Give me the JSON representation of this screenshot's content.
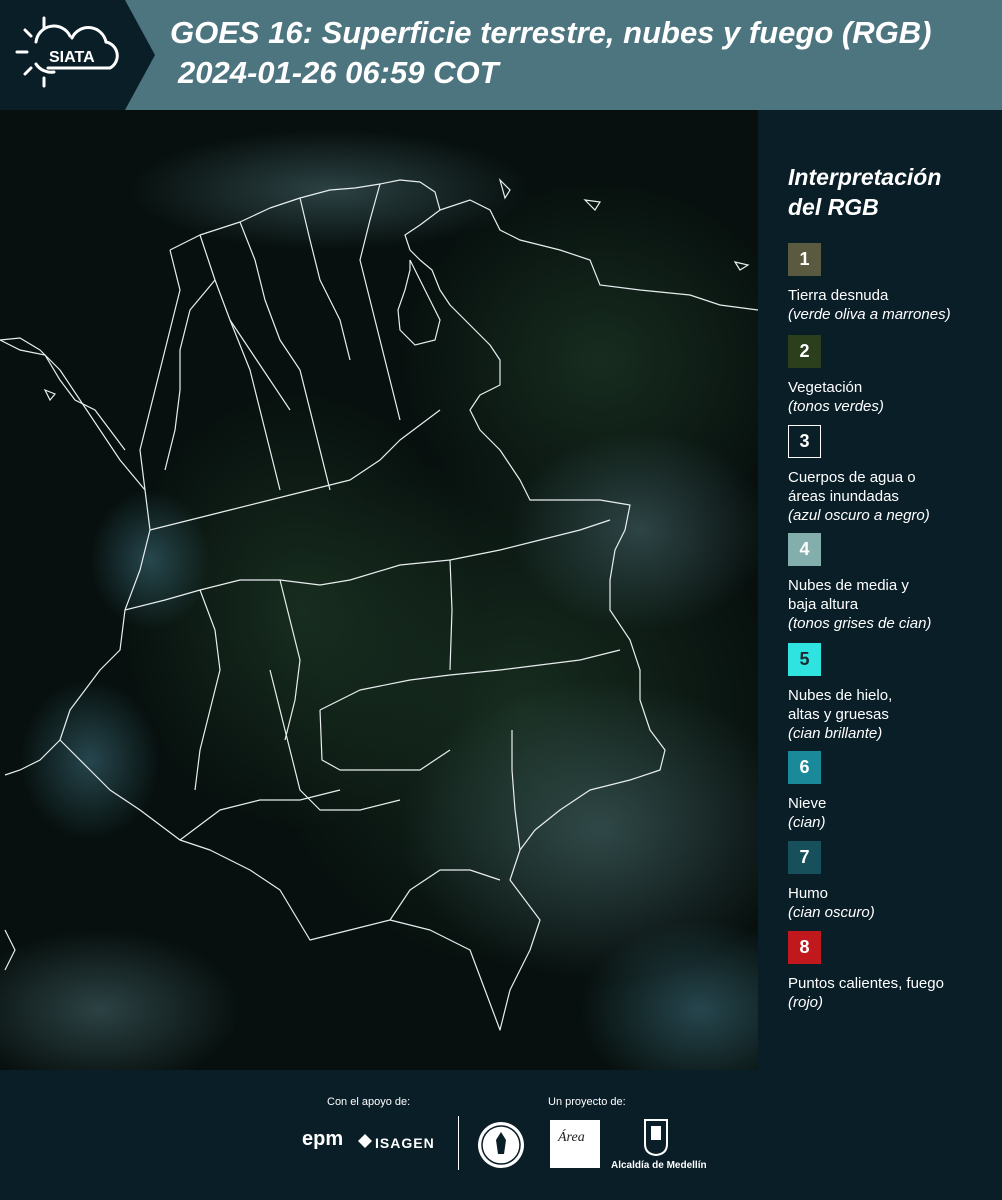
{
  "header": {
    "logo_text": "SIATA",
    "title_line1": "GOES 16: Superficie terrestre, nubes y fuego (RGB)",
    "title_line2": "2024-01-26 06:59 COT"
  },
  "legend": {
    "title_line1": "Interpretación",
    "title_line2": "del RGB",
    "items": [
      {
        "num": "1",
        "label": "Tierra desnuda",
        "sub": "(verde oliva a marrones)",
        "color": "#5a5a40",
        "text_color": "#ffffff"
      },
      {
        "num": "2",
        "label": "Vegetación",
        "sub": "(tonos verdes)",
        "color": "#2c3f1d",
        "text_color": "#ffffff"
      },
      {
        "num": "3",
        "label": "Cuerpos de agua o\náreas inundadas",
        "sub": "(azul oscuro a negro)",
        "color": "#0a1e28",
        "text_color": "#ffffff"
      },
      {
        "num": "4",
        "label": "Nubes de media y\nbaja altura",
        "sub": "(tonos grises de cian)",
        "color": "#84aeab",
        "text_color": "#ffffff"
      },
      {
        "num": "5",
        "label": "Nubes de hielo,\naltas y gruesas",
        "sub": "(cian brillante)",
        "color": "#2ee3e0",
        "text_color": "#1a2a30"
      },
      {
        "num": "6",
        "label": "Nieve",
        "sub": "(cian)",
        "color": "#1a8a9a",
        "text_color": "#ffffff"
      },
      {
        "num": "7",
        "label": "Humo",
        "sub": "(cian oscuro)",
        "color": "#17505a",
        "text_color": "#ffffff"
      },
      {
        "num": "8",
        "label": "Puntos calientes, fuego",
        "sub": "(rojo)",
        "color": "#c0181c",
        "text_color": "#ffffff"
      }
    ]
  },
  "footer": {
    "support_label": "Con el apoyo de:",
    "project_label": "Un proyecto de:",
    "epm": "epm",
    "isagen": "ISAGEN",
    "amva": "Área",
    "alcaldia": "Alcaldía de Medellín"
  }
}
